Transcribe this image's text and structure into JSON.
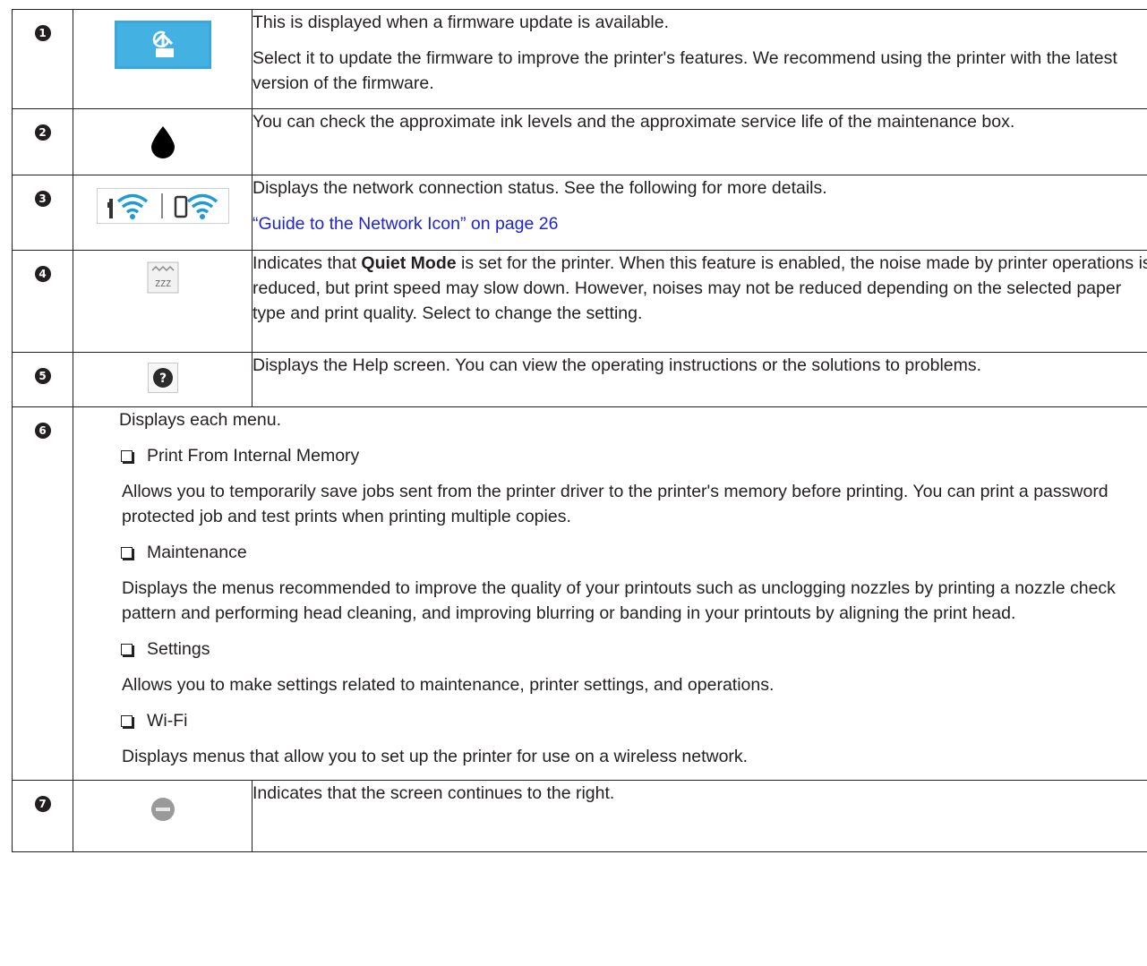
{
  "rows": [
    {
      "number": "1",
      "icon": "firmware-update-icon",
      "paragraphs": [
        "This is displayed when a firmware update is available.",
        "Select it to update the firmware to improve the printer's features. We recommend using the printer with the latest version of the firmware."
      ]
    },
    {
      "number": "2",
      "icon": "ink-drop-icon",
      "paragraphs": [
        "You can check the approximate ink levels and the approximate service life of the maintenance box."
      ]
    },
    {
      "number": "3",
      "icon": "network-status-icon",
      "paragraphs": [
        "Displays the network connection status. See the following for more details."
      ],
      "link": "“Guide to the Network Icon” on page 26"
    },
    {
      "number": "4",
      "icon": "quiet-mode-icon",
      "text_before": "Indicates that ",
      "bold": "Quiet Mode",
      "text_after": " is set for the printer. When this feature is enabled, the noise made by printer operations is reduced, but print speed may slow down. However, noises may not be reduced depending on the selected paper type and print quality. Select to change the setting."
    },
    {
      "number": "5",
      "icon": "help-icon",
      "paragraphs": [
        "Displays the Help screen. You can view the operating instructions or the solutions to problems."
      ]
    },
    {
      "number": "6",
      "intro": "Displays each menu.",
      "menus": [
        {
          "title": "Print From Internal Memory",
          "description": "Allows you to temporarily save jobs sent from the printer driver to the printer's memory before printing. You can print a password protected job and test prints when printing multiple copies."
        },
        {
          "title": "Maintenance",
          "description": "Displays the menus recommended to improve the quality of your printouts such as unclogging nozzles by printing a nozzle check pattern and performing head cleaning, and improving blurring or banding in your printouts by aligning the print head."
        },
        {
          "title": "Settings",
          "description": "Allows you to make settings related to maintenance, printer settings, and operations."
        },
        {
          "title": "Wi-Fi",
          "description": "Displays menus that allow you to set up the printer for use on a wireless network."
        }
      ]
    },
    {
      "number": "7",
      "icon": "scroll-right-icon",
      "paragraphs": [
        "Indicates that the screen continues to the right."
      ]
    }
  ],
  "colors": {
    "text": "#231f20",
    "link": "#1f25ce",
    "icon_blue": "#3aa8dc"
  }
}
